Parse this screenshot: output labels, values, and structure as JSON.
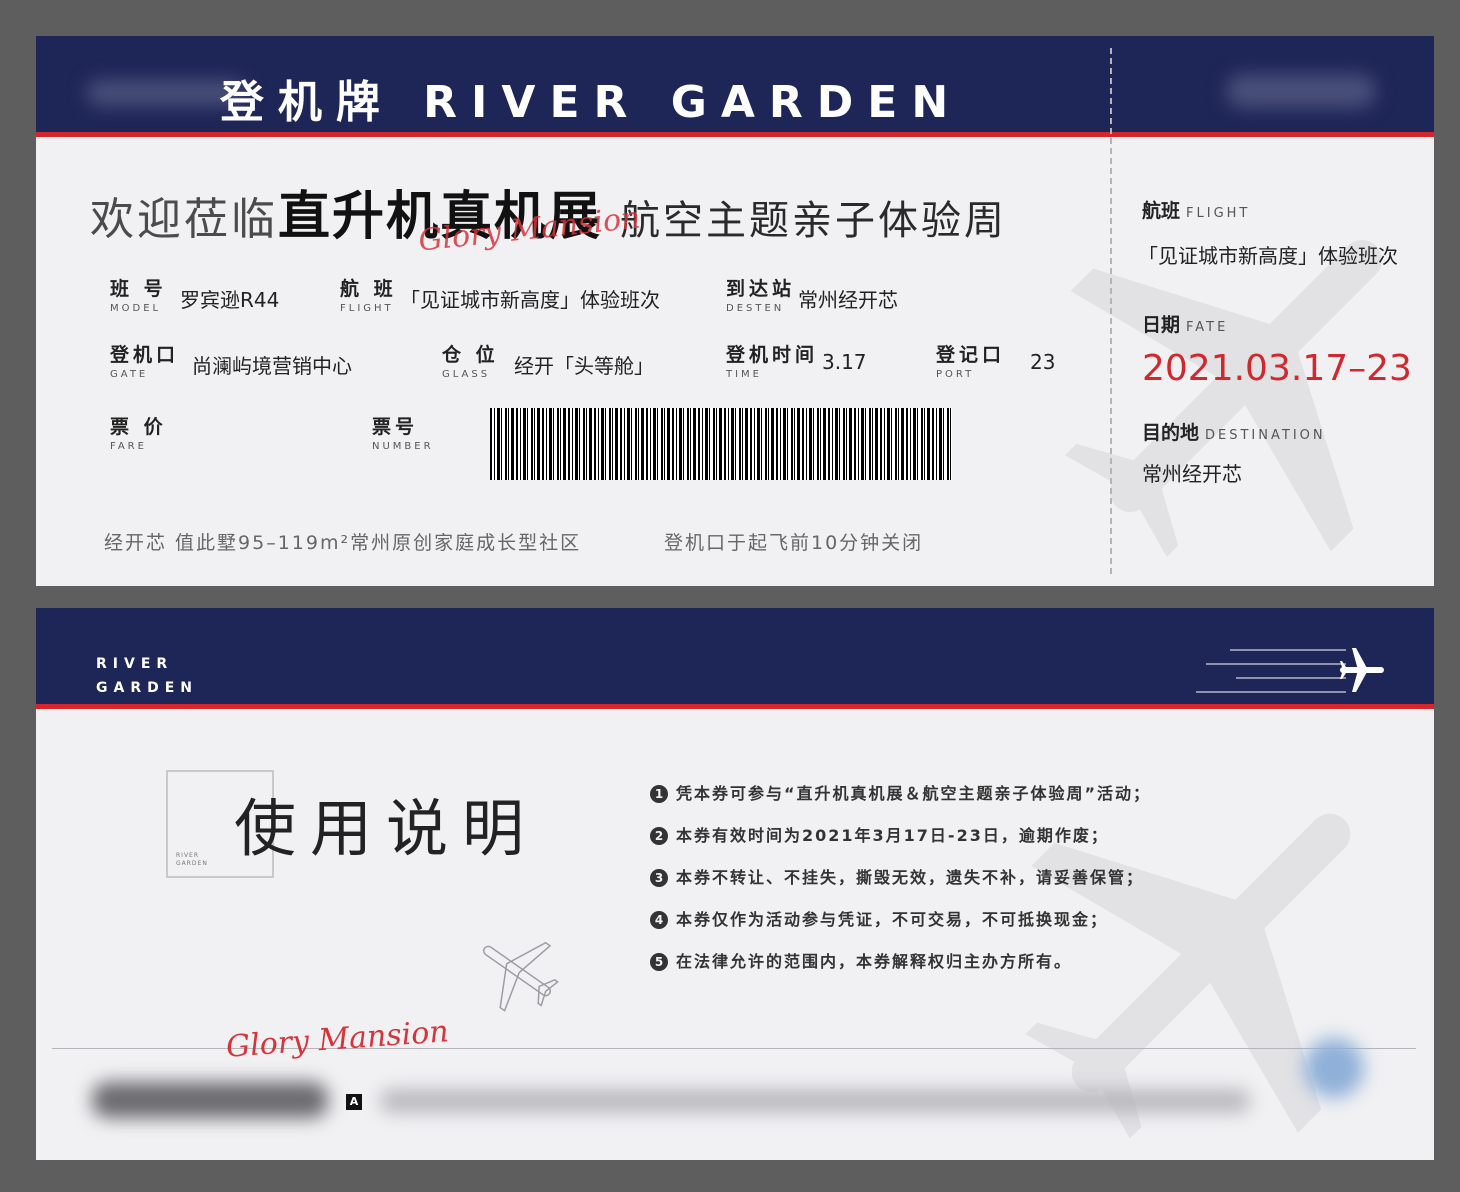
{
  "front": {
    "title": "登机牌 RIVER GARDEN",
    "headline": {
      "welcome": "欢迎莅临",
      "event": "直升机真机展",
      "subtitle": "航空主题亲子体验周"
    },
    "signature": "Glory Mansion",
    "fields": [
      {
        "label_zh": "班 号",
        "label_en": "MODEL",
        "value": "罗宾逊R44"
      },
      {
        "label_zh": "航 班",
        "label_en": "FLIGHT",
        "value": "「见证城市新高度」体验班次"
      },
      {
        "label_zh": "到达站",
        "label_en": "DESTEN",
        "value": "常州经开芯"
      },
      {
        "label_zh": "登机口",
        "label_en": "GATE",
        "value": "尚澜屿境营销中心"
      },
      {
        "label_zh": "仓 位",
        "label_en": "GLASS",
        "value": "经开「头等舱」"
      },
      {
        "label_zh": "登机时间",
        "label_en": "TIME",
        "value": "3.17"
      },
      {
        "label_zh": "登记口",
        "label_en": "PORT",
        "value": "23"
      },
      {
        "label_zh": "票 价",
        "label_en": "FARE",
        "value": ""
      },
      {
        "label_zh": "票号",
        "label_en": "NUMBER",
        "value": ""
      }
    ],
    "footer_left": "经开芯  值此墅95–119m²常州原创家庭成长型社区",
    "footer_right": "登机口于起飞前10分钟关闭",
    "stub": {
      "flight_zh": "航班",
      "flight_en": "FLIGHT",
      "flight_value": "「见证城市新高度」体验班次",
      "date_zh": "日期",
      "date_en": "FATE",
      "date_value": "2021.03.17–23",
      "dest_zh": "目的地",
      "dest_en": "DESTINATION",
      "dest_value": "常州经开芯"
    }
  },
  "back": {
    "logo_line1": "RIVER",
    "logo_line2": "GARDEN",
    "box_line1": "RIVER",
    "box_line2": "GARDEN",
    "usage_title": "使用说明",
    "rules": [
      {
        "num": "1",
        "text": "凭本券可参与“直升机真机展＆航空主题亲子体验周”活动；"
      },
      {
        "num": "2",
        "text": "本券有效时间为2021年3月17日-23日，逾期作废；"
      },
      {
        "num": "3",
        "text": "本券不转让、不挂失，撕毁无效，遗失不补，请妥善保管；"
      },
      {
        "num": "4",
        "text": "本券仅作为活动参与凭证，不可交易，不可抵换现金；"
      },
      {
        "num": "5",
        "text": "在法律允许的范围内，本券解释权归主办方所有。"
      }
    ],
    "signature": "Glory Mansion",
    "badge": "A"
  },
  "icons": {
    "plane_large": "airplane-silhouette-icon",
    "plane_band": "airplane-speed-icon",
    "plane_outline": "airplane-outline-icon"
  },
  "colors": {
    "navy": "#1e2657",
    "red": "#d7262b",
    "paper": "#f1f1f3",
    "date_red": "#d0282d"
  }
}
